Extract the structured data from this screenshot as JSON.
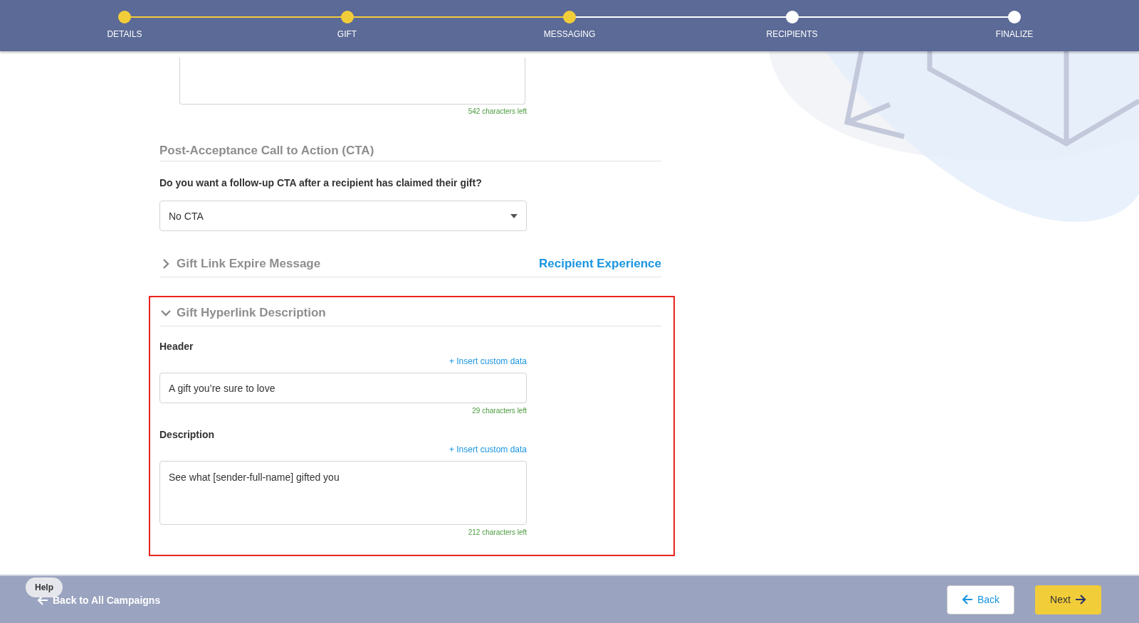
{
  "steps": [
    {
      "label": "DETAILS",
      "completed": true
    },
    {
      "label": "GIFT",
      "completed": true
    },
    {
      "label": "MESSAGING",
      "completed": true
    },
    {
      "label": "RECIPIENTS",
      "completed": false
    },
    {
      "label": "FINALIZE",
      "completed": false
    }
  ],
  "top_field": {
    "counter": "542 characters left"
  },
  "cta": {
    "heading": "Post-Acceptance Call to Action (CTA)",
    "question": "Do you want a follow-up CTA after a recipient has claimed their gift?",
    "select_value": "No CTA"
  },
  "sections": [
    {
      "title": "Gift Link Expire Message",
      "expanded": false,
      "link": "Recipient Experience",
      "highlighted": false
    },
    {
      "title": "Gift Hyperlink Description",
      "expanded": true,
      "highlighted": true,
      "fields": [
        {
          "kind": "input",
          "label": "Header",
          "insert": "+ Insert custom data",
          "value": "A gift you’re sure to love",
          "counter": "29 characters left"
        },
        {
          "kind": "textarea",
          "label": "Description",
          "insert": "+ Insert custom data",
          "value": "See what [sender-full-name] gifted you",
          "counter": "212 characters left"
        }
      ]
    }
  ],
  "footer": {
    "help": "Help",
    "back_link": "Back to All Campaigns",
    "back": "Back",
    "next": "Next"
  }
}
